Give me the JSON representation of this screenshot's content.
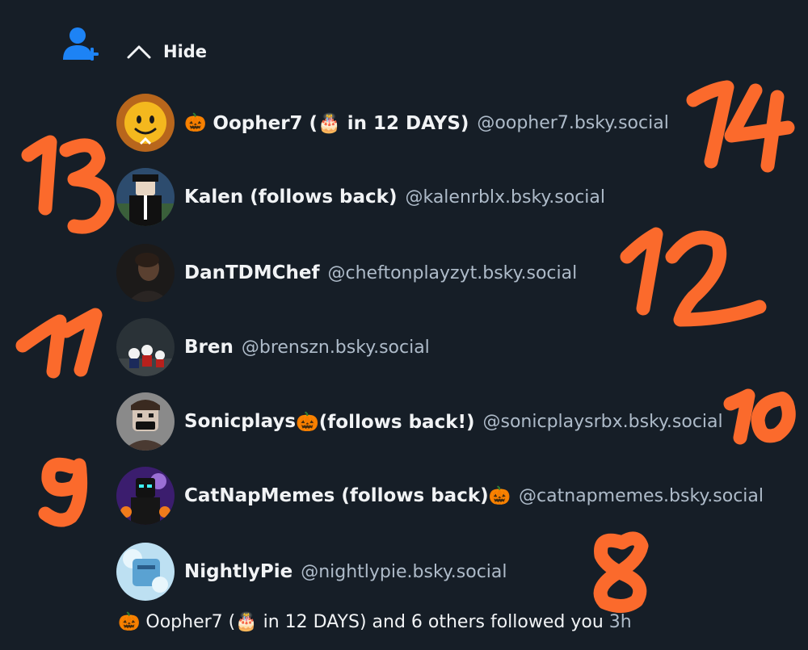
{
  "header": {
    "hide_label": "Hide",
    "icon": "person-plus-icon",
    "accent_color": "#1d83f5"
  },
  "users": [
    {
      "name_prefix": "🎃",
      "name": "Oopher7 (🎂 in 12 DAYS)",
      "name_suffix": "",
      "handle": "@oopher7.bsky.social",
      "avatar": "yellow-smiley-roblox-avatar"
    },
    {
      "name_prefix": "",
      "name": "Kalen (follows back)",
      "name_suffix": "",
      "handle": "@kalenrblx.bsky.social",
      "avatar": "suited-roblox-avatar"
    },
    {
      "name_prefix": "",
      "name": "DanTDMChef",
      "name_suffix": "",
      "handle": "@cheftonplayzyt.bsky.social",
      "avatar": "dark-portrait-avatar"
    },
    {
      "name_prefix": "",
      "name": "Bren",
      "name_suffix": "",
      "handle": "@brenszn.bsky.social",
      "avatar": "skeleton-group-avatar"
    },
    {
      "name_prefix": "",
      "name": "Sonicplays",
      "name_suffix": "🎃(follows back!)",
      "handle": "@sonicplaysrbx.bsky.social",
      "avatar": "cartoon-face-avatar"
    },
    {
      "name_prefix": "",
      "name": "CatNapMemes (follows back)",
      "name_suffix": "🎃",
      "handle": "@catnapmemes.bsky.social",
      "avatar": "purple-halloween-avatar"
    },
    {
      "name_prefix": "",
      "name": "NightlyPie",
      "name_suffix": "",
      "handle": "@nightlypie.bsky.social",
      "avatar": "blue-icy-avatar"
    }
  ],
  "summary": {
    "text": "🎃 Oopher7 (🎂 in 12 DAYS) and 6 others followed you",
    "time": "3h"
  },
  "annotations": [
    "14",
    "13",
    "12",
    "11",
    "10",
    "9",
    "8"
  ],
  "annotation_color": "#fb6a2c"
}
